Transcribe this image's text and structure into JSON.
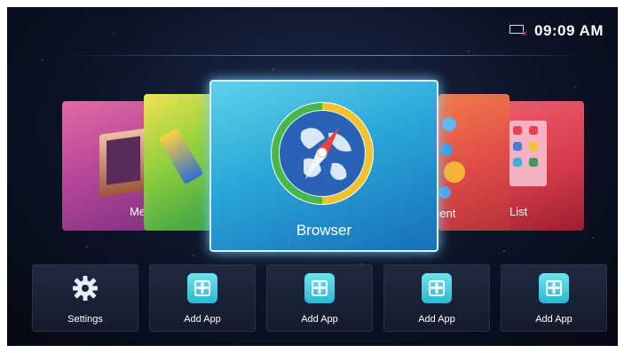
{
  "status": {
    "time": "09:09  AM",
    "network_icon": "network-disconnected-icon"
  },
  "carousel": {
    "cards": [
      {
        "id": "media",
        "label": "Me",
        "icon": "media-film-icon"
      },
      {
        "id": "files",
        "label": "",
        "icon": "usb-drive-icon"
      },
      {
        "id": "browser",
        "label": "Browser",
        "icon": "compass-globe-icon",
        "focused": true
      },
      {
        "id": "apps",
        "label": "nent",
        "icon": "app-bubbles-icon"
      },
      {
        "id": "list",
        "label": "List",
        "icon": "app-grid-icon"
      }
    ]
  },
  "tiles": [
    {
      "label": "Settings",
      "icon": "gear-icon"
    },
    {
      "label": "Add App",
      "icon": "add-app-icon"
    },
    {
      "label": "Add App",
      "icon": "add-app-icon"
    },
    {
      "label": "Add App",
      "icon": "add-app-icon"
    },
    {
      "label": "Add App",
      "icon": "add-app-icon"
    }
  ],
  "colors": {
    "focus_glow": "#78d2ff",
    "add_icon": "#2bb7d4"
  }
}
